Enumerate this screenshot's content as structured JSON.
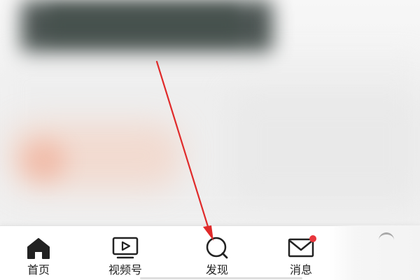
{
  "bottom_nav": {
    "tabs": [
      {
        "id": "home",
        "label": "首页",
        "icon": "home-icon"
      },
      {
        "id": "video",
        "label": "视频号",
        "icon": "video-play-icon"
      },
      {
        "id": "discover",
        "label": "发现",
        "icon": "search-icon"
      },
      {
        "id": "messages",
        "label": "消息",
        "icon": "mail-icon",
        "has_badge": true
      }
    ]
  },
  "colors": {
    "icon": "#222222",
    "badge": "#e8363c",
    "annotation_arrow": "#e02a2a"
  }
}
